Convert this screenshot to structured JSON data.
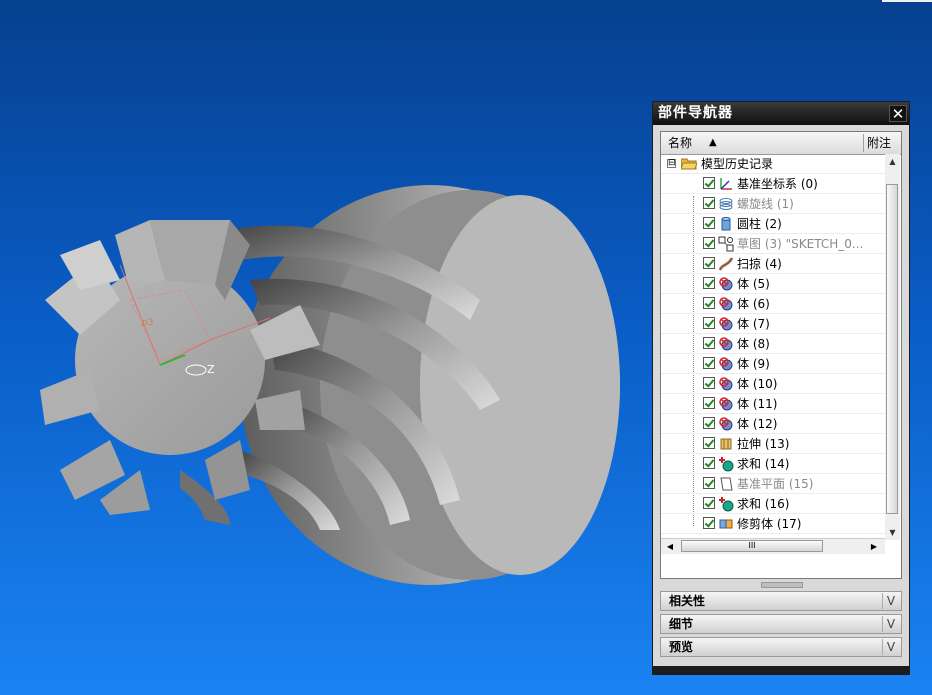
{
  "navigator": {
    "title": "部件导航器",
    "close_glyph": "✕",
    "header": {
      "name": "名称",
      "sort_glyph": "▲",
      "notes": "附注"
    },
    "root": {
      "label": "模型历史记录",
      "toggle": "⊟",
      "icon": "folder-open-icon"
    },
    "items": [
      {
        "label": "基准坐标系 (0)",
        "icon": "datum-csys-icon",
        "dim": false
      },
      {
        "label": "螺旋线 (1)",
        "icon": "helix-icon",
        "dim": true
      },
      {
        "label": "圆柱 (2)",
        "icon": "cylinder-icon",
        "dim": false
      },
      {
        "label": "草图 (3) \"SKETCH_0...",
        "icon": "sketch-icon",
        "dim": true
      },
      {
        "label": "扫掠 (4)",
        "icon": "sweep-icon",
        "dim": false
      },
      {
        "label": "体 (5)",
        "icon": "body-icon",
        "dim": false
      },
      {
        "label": "体 (6)",
        "icon": "body-icon",
        "dim": false
      },
      {
        "label": "体 (7)",
        "icon": "body-icon",
        "dim": false
      },
      {
        "label": "体 (8)",
        "icon": "body-icon",
        "dim": false
      },
      {
        "label": "体 (9)",
        "icon": "body-icon",
        "dim": false
      },
      {
        "label": "体 (10)",
        "icon": "body-icon",
        "dim": false
      },
      {
        "label": "体 (11)",
        "icon": "body-icon",
        "dim": false
      },
      {
        "label": "体 (12)",
        "icon": "body-icon",
        "dim": false
      },
      {
        "label": "拉伸 (13)",
        "icon": "extrude-icon",
        "dim": false
      },
      {
        "label": "求和 (14)",
        "icon": "unite-icon",
        "dim": false
      },
      {
        "label": "基准平面 (15)",
        "icon": "datum-plane-icon",
        "dim": true
      },
      {
        "label": "求和 (16)",
        "icon": "unite-icon",
        "dim": false
      },
      {
        "label": "修剪体 (17)",
        "icon": "trim-body-icon",
        "dim": false
      }
    ],
    "hscroll_grip": "III",
    "sections": [
      {
        "label": "相关性",
        "chevron": "V"
      },
      {
        "label": "细节",
        "chevron": "V"
      },
      {
        "label": "预览",
        "chevron": "V"
      }
    ]
  },
  "viewport": {
    "triad_label": "Z",
    "dimension_label": "p3"
  },
  "colors": {
    "check": "#1a8a1a",
    "panel_title": "#111111",
    "bg_top": "#06408f",
    "bg_bottom": "#1a83f2"
  }
}
